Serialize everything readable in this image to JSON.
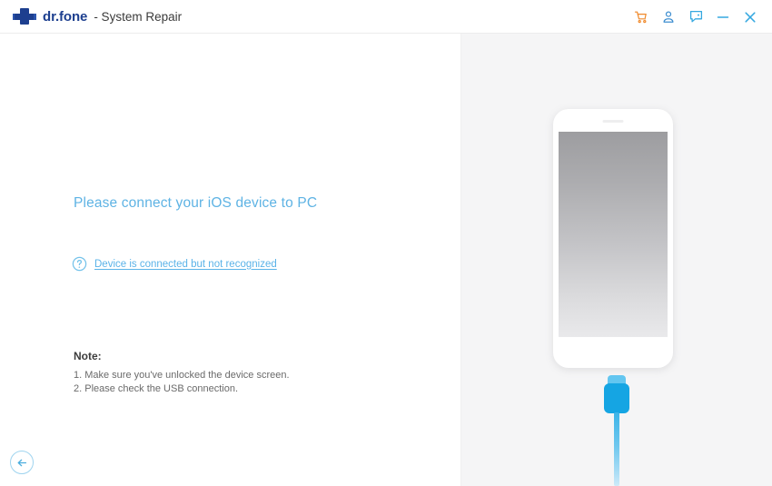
{
  "titlebar": {
    "brand": "dr.fone",
    "separator_title": "- System Repair",
    "logo_icon": "drfone-cross-logo",
    "actions": [
      {
        "name": "cart-icon",
        "label": "Shopping Cart",
        "color": "#f0892a"
      },
      {
        "name": "account-icon",
        "label": "Account",
        "color": "#3a8fd4"
      },
      {
        "name": "feedback-icon",
        "label": "Feedback",
        "color": "#35a8e0"
      },
      {
        "name": "minimize-icon",
        "label": "Minimize",
        "color": "#35a8e0"
      },
      {
        "name": "close-icon",
        "label": "Close",
        "color": "#35a8e0"
      }
    ]
  },
  "main": {
    "headline": "Please connect your iOS device to PC",
    "help_icon": "question-circle-icon",
    "help_link": "Device is connected but not recognized",
    "note": {
      "title": "Note:",
      "items": [
        "1. Make sure you've unlocked the device screen.",
        "2. Please check the USB connection."
      ]
    },
    "back_button_icon": "arrow-left-icon"
  },
  "illustration": {
    "device_name": "ios-phone-illustration",
    "cable_name": "usb-lightning-cable",
    "screen_gradient_top": "#9d9da0",
    "screen_gradient_bottom": "#e9e9eb",
    "cable_color": "#15a5e3",
    "cable_tip_color": "#63c6f0"
  },
  "theme": {
    "accent_blue": "#5bb3e8",
    "brand_navy": "#1d3f8f",
    "panel_gray": "#f5f5f6",
    "cart_orange": "#f0892a"
  }
}
